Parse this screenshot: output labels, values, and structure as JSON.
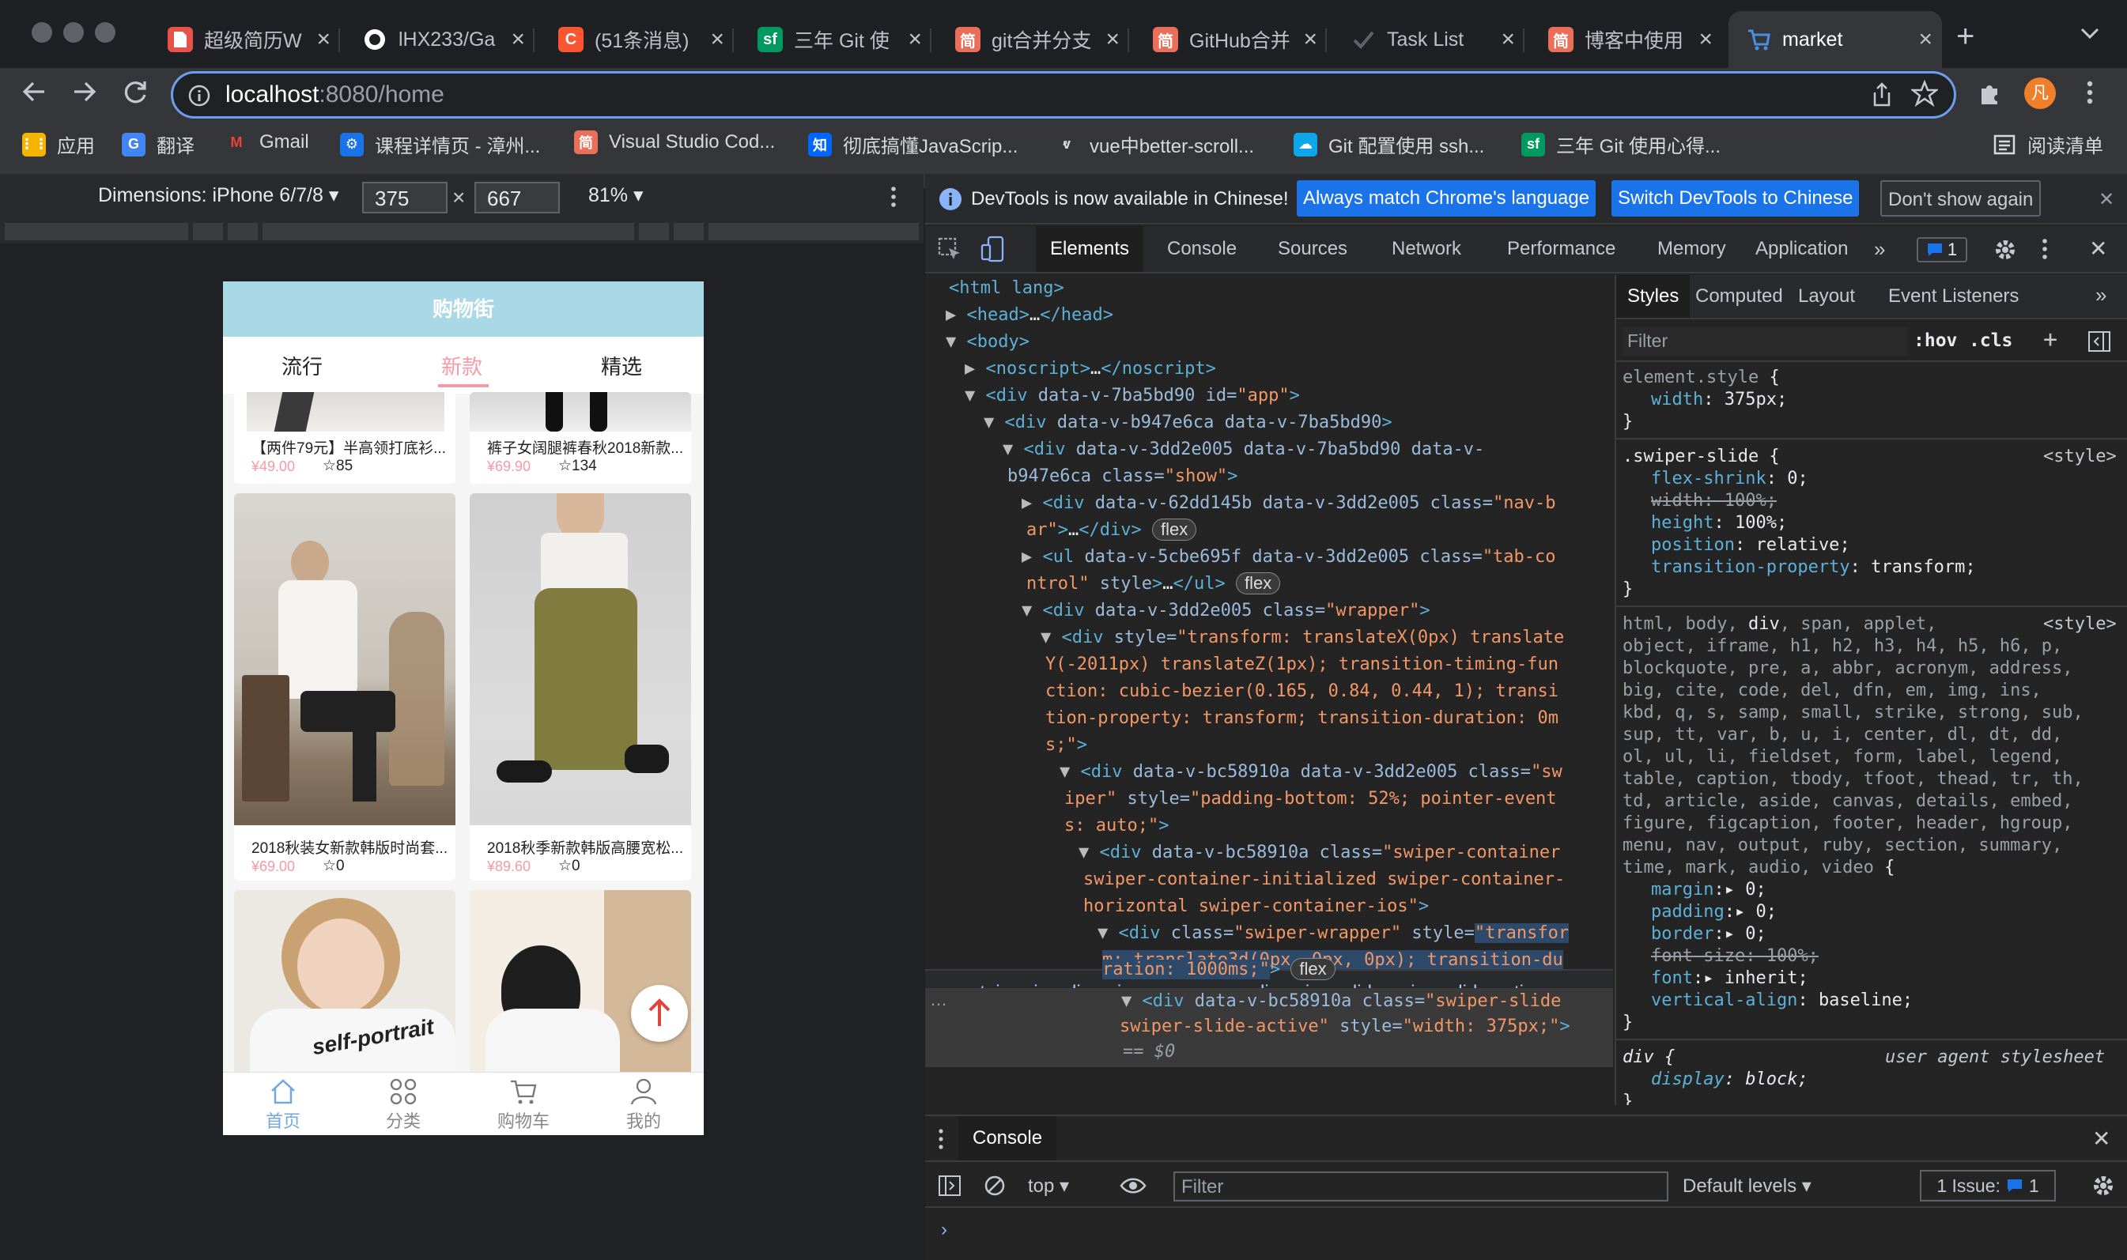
{
  "browser": {
    "tabs": [
      {
        "title": "超级简历W",
        "icon": "doc-icon",
        "color": "#e5534b"
      },
      {
        "title": "lHX233/Ga",
        "icon": "github-icon",
        "color": "#ffffff"
      },
      {
        "title": "(51条消息)",
        "icon": "csdn-icon",
        "color": "#fc5531"
      },
      {
        "title": "三年 Git 使",
        "icon": "sf-icon",
        "color": "#009a61"
      },
      {
        "title": "git合并分支",
        "icon": "jianshu-icon",
        "color": "#ea6f5a"
      },
      {
        "title": "GitHub合并",
        "icon": "jianshu-icon",
        "color": "#ea6f5a"
      },
      {
        "title": "Task List",
        "icon": "check-icon",
        "color": "#5f6368"
      },
      {
        "title": "博客中使用",
        "icon": "jianshu-icon",
        "color": "#ea6f5a"
      },
      {
        "title": "market",
        "icon": "cart-icon",
        "color": "#4a90e2"
      }
    ],
    "url_host": "localhost",
    "url_path": ":8080/home",
    "bookmarks": [
      {
        "label": "应用"
      },
      {
        "label": "翻译"
      },
      {
        "label": "Gmail"
      },
      {
        "label": "课程详情页 - 漳州..."
      },
      {
        "label": "Visual Studio Cod..."
      },
      {
        "label": "彻底搞懂JavaScrip..."
      },
      {
        "label": "vue中better-scroll..."
      },
      {
        "label": "Git 配置使用 ssh..."
      },
      {
        "label": "三年 Git 使用心得..."
      }
    ],
    "reading_list": "阅读清单",
    "avatar_letter": "凡"
  },
  "device": {
    "dimensions_label": "Dimensions: iPhone 6/7/8",
    "width": "375",
    "times": "×",
    "height": "667",
    "zoom": "81%"
  },
  "app": {
    "title": "购物街",
    "tabs": [
      "流行",
      "新款",
      "精选"
    ],
    "selected_tab": "新款",
    "products": [
      {
        "title": "【两件79元】半高领打底衫...",
        "price": "¥49.00",
        "favs": "85"
      },
      {
        "title": "裤子女阔腿裤春秋2018新款...",
        "price": "¥69.90",
        "favs": "134"
      },
      {
        "title": "2018秋装女新款韩版时尚套...",
        "price": "¥69.00",
        "favs": "0"
      },
      {
        "title": "2018秋季新款韩版高腰宽松...",
        "price": "¥89.60",
        "favs": "0"
      }
    ],
    "tabbar": [
      "首页",
      "分类",
      "购物车",
      "我的"
    ],
    "shirt_print": "self-portrait"
  },
  "devtools": {
    "info_text": "DevTools is now available in Chinese!",
    "btn_match": "Always match Chrome's language",
    "btn_switch": "Switch DevTools to Chinese",
    "btn_dont": "Don't show again",
    "tabs": [
      "Elements",
      "Console",
      "Sources",
      "Network",
      "Performance",
      "Memory",
      "Application"
    ],
    "issues_badge": "1",
    "breadcrumbs": [
      "...",
      "ntainer-ios",
      "div.swiper-wrapper",
      "div.swiper-slide.swiper-slide-active",
      "..."
    ],
    "style_tabs": [
      "Styles",
      "Computed",
      "Layout",
      "Event Listeners"
    ],
    "filter_placeholder": "Filter",
    "hov": ":hov",
    "cls": ".cls",
    "console_tab": "Console",
    "console_context": "top",
    "console_filter": "Filter",
    "default_levels": "Default levels",
    "issue_text": "1 Issue:",
    "issue_count": "1"
  }
}
